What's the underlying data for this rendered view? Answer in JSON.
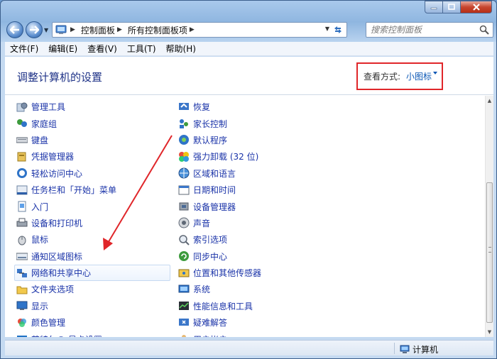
{
  "window": {
    "caption_buttons": {
      "minimize": "minimize-icon",
      "maximize": "maximize-icon",
      "close": "close-icon"
    }
  },
  "address_bar": {
    "crumbs": [
      "控制面板",
      "所有控制面板项"
    ]
  },
  "search": {
    "placeholder": "搜索控制面板"
  },
  "menu": [
    "文件(F)",
    "编辑(E)",
    "查看(V)",
    "工具(T)",
    "帮助(H)"
  ],
  "header": {
    "title": "调整计算机的设置",
    "view_by_label": "查看方式:",
    "view_by_value": "小图标",
    "highlight_color": "#e0262a"
  },
  "items": {
    "left": [
      {
        "label": "管理工具",
        "icon": "admin-tools-icon"
      },
      {
        "label": "家庭组",
        "icon": "homegroup-icon"
      },
      {
        "label": "键盘",
        "icon": "keyboard-icon"
      },
      {
        "label": "凭据管理器",
        "icon": "credential-manager-icon"
      },
      {
        "label": "轻松访问中心",
        "icon": "ease-of-access-icon"
      },
      {
        "label": "任务栏和「开始」菜单",
        "icon": "taskbar-icon"
      },
      {
        "label": "入门",
        "icon": "getting-started-icon"
      },
      {
        "label": "设备和打印机",
        "icon": "devices-printers-icon"
      },
      {
        "label": "鼠标",
        "icon": "mouse-icon"
      },
      {
        "label": "通知区域图标",
        "icon": "notification-area-icon"
      },
      {
        "label": "网络和共享中心",
        "icon": "network-sharing-icon"
      },
      {
        "label": "文件夹选项",
        "icon": "folder-options-icon"
      },
      {
        "label": "显示",
        "icon": "display-icon"
      },
      {
        "label": "颜色管理",
        "icon": "color-management-icon"
      },
      {
        "label": "英特尔® 显卡设置",
        "icon": "intel-graphics-icon"
      }
    ],
    "right": [
      {
        "label": "恢复",
        "icon": "recovery-icon"
      },
      {
        "label": "家长控制",
        "icon": "parental-controls-icon"
      },
      {
        "label": "默认程序",
        "icon": "default-programs-icon"
      },
      {
        "label": "强力卸载 (32 位)",
        "icon": "uninstaller-icon"
      },
      {
        "label": "区域和语言",
        "icon": "region-language-icon"
      },
      {
        "label": "日期和时间",
        "icon": "date-time-icon"
      },
      {
        "label": "设备管理器",
        "icon": "device-manager-icon"
      },
      {
        "label": "声音",
        "icon": "sound-icon"
      },
      {
        "label": "索引选项",
        "icon": "indexing-options-icon"
      },
      {
        "label": "同步中心",
        "icon": "sync-center-icon"
      },
      {
        "label": "位置和其他传感器",
        "icon": "location-sensors-icon"
      },
      {
        "label": "系统",
        "icon": "system-icon"
      },
      {
        "label": "性能信息和工具",
        "icon": "performance-icon"
      },
      {
        "label": "疑难解答",
        "icon": "troubleshooting-icon"
      },
      {
        "label": "用户帐户",
        "icon": "user-accounts-icon"
      }
    ],
    "selected_label": "网络和共享中心"
  },
  "status": {
    "computer": "计算机"
  },
  "annotation": {
    "arrow_color": "#e0262a"
  }
}
